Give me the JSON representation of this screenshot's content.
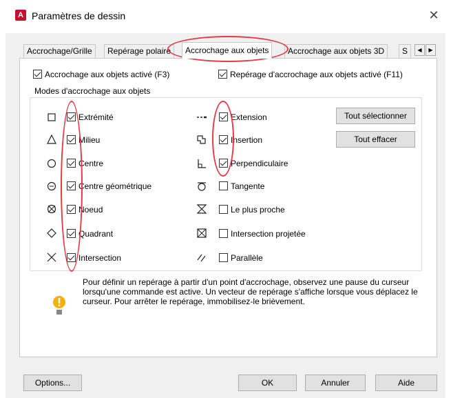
{
  "window": {
    "title": "Paramètres de dessin",
    "app_icon_letter": "A"
  },
  "tabs": [
    {
      "label": "Accrochage/Grille"
    },
    {
      "label": "Repérage polaire"
    },
    {
      "label": "Accrochage aux objets",
      "active": true
    },
    {
      "label": "Accrochage aux objets 3D"
    },
    {
      "label": "S"
    }
  ],
  "top_options": {
    "osnap_on": {
      "label": "Accrochage aux objets activé (F3)",
      "checked": true
    },
    "tracking_on": {
      "label": "Repérage d'accrochage aux objets activé (F11)",
      "checked": true
    }
  },
  "group": {
    "title": "Modes d'accrochage aux objets",
    "left_modes": [
      {
        "label": "Extrémité",
        "checked": true,
        "icon": "endpoint-icon"
      },
      {
        "label": "Milieu",
        "checked": true,
        "icon": "midpoint-icon"
      },
      {
        "label": "Centre",
        "checked": true,
        "icon": "center-icon"
      },
      {
        "label": "Centre géométrique",
        "checked": true,
        "icon": "geometric-center-icon"
      },
      {
        "label": "Noeud",
        "checked": true,
        "icon": "node-icon"
      },
      {
        "label": "Quadrant",
        "checked": true,
        "icon": "quadrant-icon"
      },
      {
        "label": "Intersection",
        "checked": true,
        "icon": "intersection-icon"
      }
    ],
    "right_modes": [
      {
        "label": "Extension",
        "checked": true,
        "icon": "extension-icon"
      },
      {
        "label": "Insertion",
        "checked": true,
        "icon": "insertion-icon"
      },
      {
        "label": "Perpendiculaire",
        "checked": true,
        "icon": "perpendicular-icon"
      },
      {
        "label": "Tangente",
        "checked": false,
        "icon": "tangent-icon"
      },
      {
        "label": "Le plus proche",
        "checked": false,
        "icon": "nearest-icon"
      },
      {
        "label": "Intersection projetée",
        "checked": false,
        "icon": "apparent-intersection-icon"
      },
      {
        "label": "Parallèle",
        "checked": false,
        "icon": "parallel-icon"
      }
    ],
    "select_all_label": "Tout sélectionner",
    "clear_all_label": "Tout effacer"
  },
  "info": {
    "text": "Pour définir un repérage à partir d'un point d'accrochage, observez une pause du curseur lorsqu'une commande est active. Un vecteur de repérage s'affiche lorsque vous déplacez le curseur. Pour arrêter le repérage, immobilisez-le brièvement."
  },
  "footer": {
    "options_label": "Options...",
    "ok_label": "OK",
    "cancel_label": "Annuler",
    "help_label": "Aide"
  },
  "colors": {
    "annotation": "#e53945",
    "app_icon": "#c8102e",
    "info_icon": "#f2b10e"
  }
}
